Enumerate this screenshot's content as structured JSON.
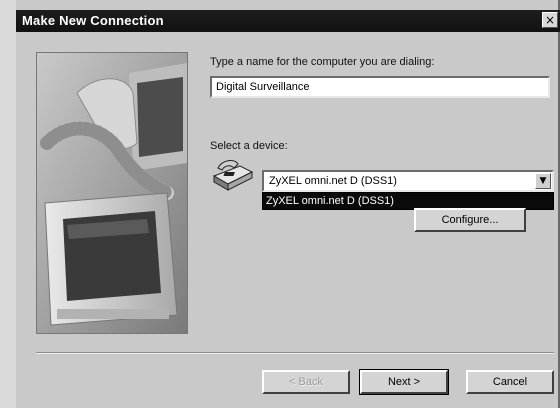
{
  "window": {
    "title": "Make New Connection",
    "close_glyph": "×"
  },
  "name_field": {
    "label": "Type a name for the computer you are dialing:",
    "value": "Digital Surveillance"
  },
  "device": {
    "label": "Select a device:",
    "selected": "ZyXEL omni.net D (DSS1)",
    "options": [
      "ZyXEL omni.net D (DSS1)"
    ],
    "arrow_glyph": "▼",
    "icon": "modem-icon"
  },
  "buttons": {
    "configure": "Configure...",
    "back": "< Back",
    "next": "Next >",
    "cancel": "Cancel"
  },
  "colors": {
    "titlebar": "#111111",
    "dialog": "#c9c9c9",
    "selection": "#0a0a0a"
  }
}
